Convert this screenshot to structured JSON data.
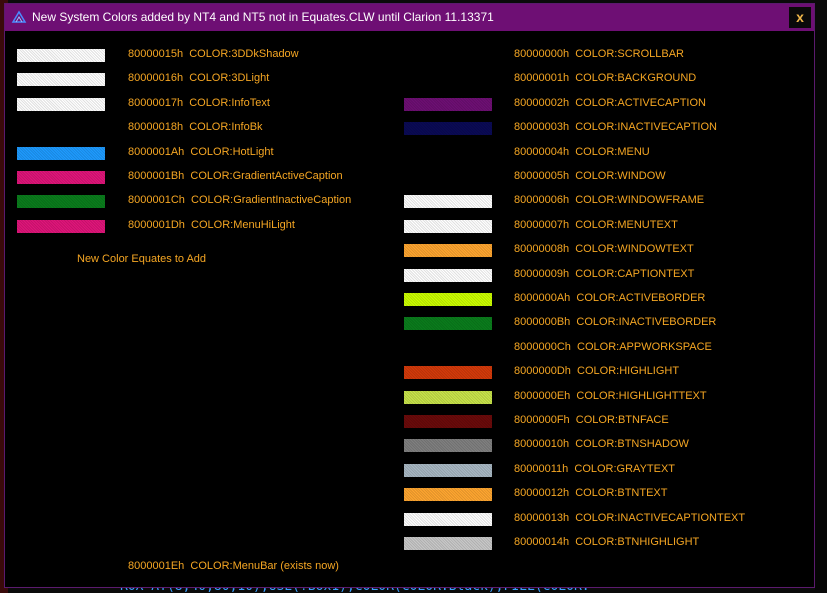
{
  "window": {
    "title": "New System Colors added by NT4 and NT5 not in Equates.CLW until Clarion 11.13371",
    "close_label": "x"
  },
  "background": {
    "bottom_code": "ROX AT(8,40,80,10),USE(?Box1),COLOR(COLOR:Black),FILL(COLOR:"
  },
  "left_column": [
    {
      "code": "80000015h",
      "name": "COLOR:3DDkShadow",
      "swatch": "#ffffff"
    },
    {
      "code": "80000016h",
      "name": "COLOR:3DLight",
      "swatch": "#ffffff"
    },
    {
      "code": "80000017h",
      "name": "COLOR:InfoText",
      "swatch": "#ffffff"
    },
    {
      "code": "80000018h",
      "name": "COLOR:InfoBk",
      "swatch": ""
    },
    {
      "code": "8000001Ah",
      "name": "COLOR:HotLight",
      "swatch": "#1e9bff"
    },
    {
      "code": "8000001Bh",
      "name": "COLOR:GradientActiveCaption",
      "swatch": "#e0157a"
    },
    {
      "code": "8000001Ch",
      "name": "COLOR:GradientInactiveCaption",
      "swatch": "#0a7d1c"
    },
    {
      "code": "8000001Dh",
      "name": "COLOR:MenuHiLight",
      "swatch": "#e0157a"
    }
  ],
  "new_equates_label": "New Color Equates to Add",
  "menubar_item": {
    "code": "8000001Eh",
    "name": "COLOR:MenuBar (exists now)"
  },
  "right_column": [
    {
      "code": "80000000h",
      "name": "COLOR:SCROLLBAR",
      "swatch": ""
    },
    {
      "code": "80000001h",
      "name": "COLOR:BACKGROUND",
      "swatch": ""
    },
    {
      "code": "80000002h",
      "name": "COLOR:ACTIVECAPTION",
      "swatch": "#6e0f74"
    },
    {
      "code": "80000003h",
      "name": "COLOR:INACTIVECAPTION",
      "swatch": "#0a0a55"
    },
    {
      "code": "80000004h",
      "name": "COLOR:MENU",
      "swatch": ""
    },
    {
      "code": "80000005h",
      "name": "COLOR:WINDOW",
      "swatch": ""
    },
    {
      "code": "80000006h",
      "name": "COLOR:WINDOWFRAME",
      "swatch": "#ffffff"
    },
    {
      "code": "80000007h",
      "name": "COLOR:MENUTEXT",
      "swatch": "#ffffff"
    },
    {
      "code": "80000008h",
      "name": "COLOR:WINDOWTEXT",
      "swatch": "#ffa630"
    },
    {
      "code": "80000009h",
      "name": "COLOR:CAPTIONTEXT",
      "swatch": "#ffffff"
    },
    {
      "code": "8000000Ah",
      "name": "COLOR:ACTIVEBORDER",
      "swatch": "#ccff00"
    },
    {
      "code": "8000000Bh",
      "name": "COLOR:INACTIVEBORDER",
      "swatch": "#0a7d1c"
    },
    {
      "code": "8000000Ch",
      "name": "COLOR:APPWORKSPACE",
      "swatch": ""
    },
    {
      "code": "8000000Dh",
      "name": "COLOR:HIGHLIGHT",
      "swatch": "#d43a0a"
    },
    {
      "code": "8000000Eh",
      "name": "COLOR:HIGHLIGHTTEXT",
      "swatch": "#c8e44a"
    },
    {
      "code": "8000000Fh",
      "name": "COLOR:BTNFACE",
      "swatch": "#6b0a0a"
    },
    {
      "code": "80000010h",
      "name": "COLOR:BTNSHADOW",
      "swatch": "#808080"
    },
    {
      "code": "80000011h",
      "name": "COLOR:GRAYTEXT",
      "swatch": "#a8b8c4"
    },
    {
      "code": "80000012h",
      "name": "COLOR:BTNTEXT",
      "swatch": "#ffa630"
    },
    {
      "code": "80000013h",
      "name": "COLOR:INACTIVECAPTIONTEXT",
      "swatch": "#ffffff"
    },
    {
      "code": "80000014h",
      "name": "COLOR:BTNHIGHLIGHT",
      "swatch": "#c8c8c8"
    }
  ]
}
